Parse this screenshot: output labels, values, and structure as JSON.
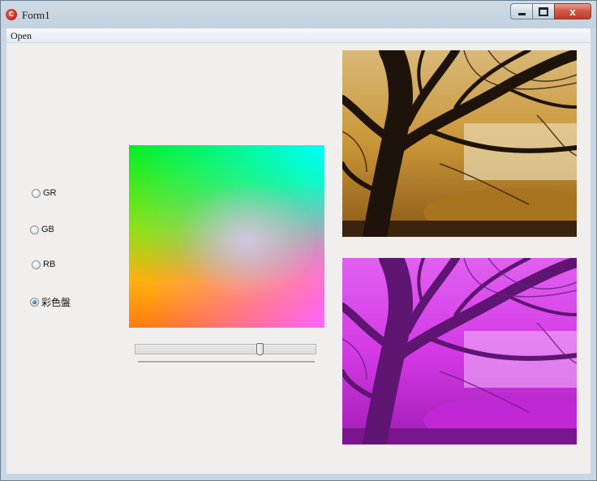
{
  "window": {
    "title": "Form1",
    "icon": "app-icon",
    "buttons": [
      "minimize-icon",
      "maximize-icon",
      "close-icon"
    ],
    "close_glyph": "x"
  },
  "menu": {
    "items": [
      {
        "label": "Open"
      }
    ]
  },
  "options": {
    "items": [
      {
        "label": "GR",
        "selected": false
      },
      {
        "label": "GB",
        "selected": false
      },
      {
        "label": "RB",
        "selected": false
      },
      {
        "label": "彩色盤",
        "selected": true
      }
    ]
  },
  "palette": {
    "corners": {
      "top_left": "#00f020",
      "top_right": "#00ffff",
      "bottom_left": "#ff7a12",
      "bottom_right": "#ff5aff"
    }
  },
  "slider": {
    "value_fraction": 0.7
  },
  "images": {
    "original": {
      "description_icon": "tree-photo",
      "tint": "#c8962e"
    },
    "processed": {
      "description_icon": "tree-photo-magenta",
      "tint": "#d21ee0"
    }
  }
}
